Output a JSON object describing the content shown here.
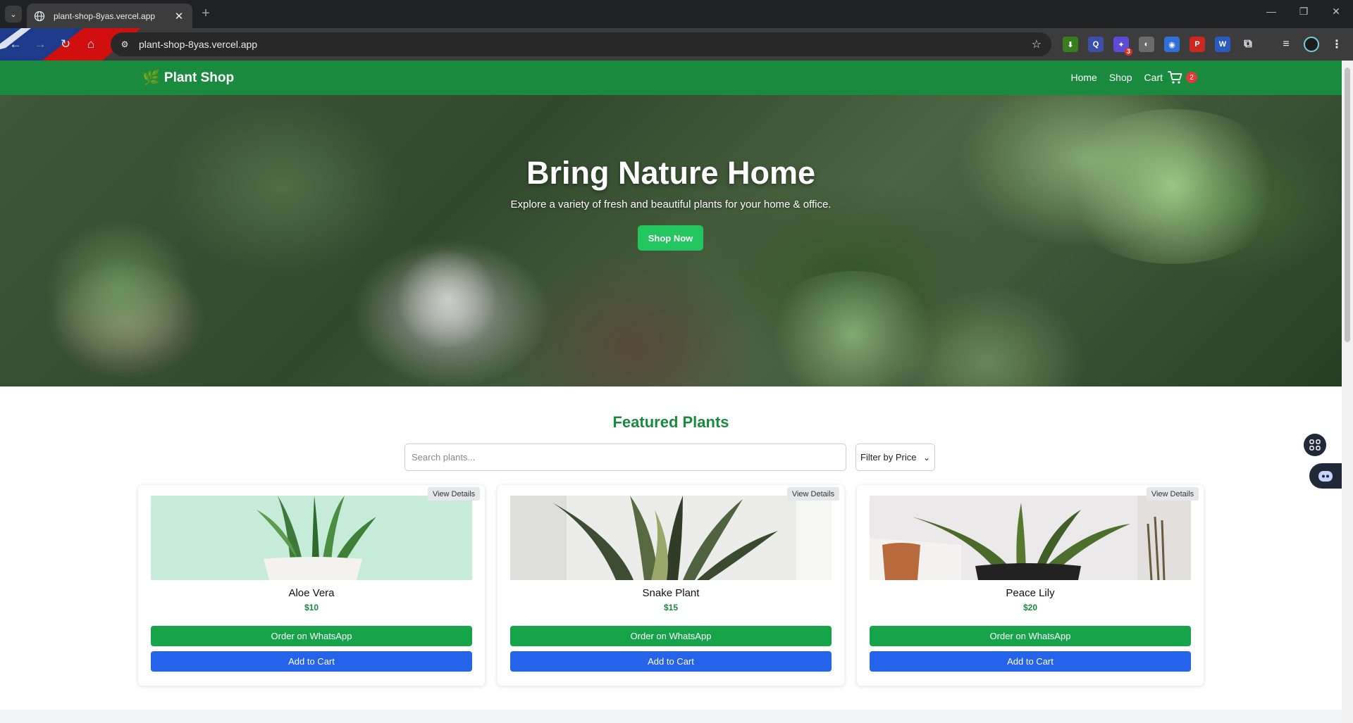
{
  "browser": {
    "tab_title": "plant-shop-8yas.vercel.app",
    "url": "plant-shop-8yas.vercel.app",
    "extension_badge": "3"
  },
  "site": {
    "brand": "Plant Shop",
    "nav": [
      "Home",
      "Shop",
      "Cart"
    ],
    "cart_count": "2"
  },
  "hero": {
    "title": "Bring Nature Home",
    "subtitle": "Explore a variety of fresh and beautiful plants for your home & office.",
    "cta": "Shop Now"
  },
  "featured": {
    "title": "Featured Plants",
    "search_placeholder": "Search plants...",
    "filter_label": "Filter by Price"
  },
  "products": [
    {
      "name": "Aloe Vera",
      "price": "$10",
      "details": "View Details",
      "order": "Order on WhatsApp",
      "add": "Add to Cart"
    },
    {
      "name": "Snake Plant",
      "price": "$15",
      "details": "View Details",
      "order": "Order on WhatsApp",
      "add": "Add to Cart"
    },
    {
      "name": "Peace Lily",
      "price": "$20",
      "details": "View Details",
      "order": "Order on WhatsApp",
      "add": "Add to Cart"
    }
  ],
  "colors": {
    "brand_green": "#1a8a3f",
    "whatsapp_green": "#16a34a",
    "cart_blue": "#2563eb",
    "cta_green": "#22c55e",
    "badge_red": "#e53935"
  }
}
